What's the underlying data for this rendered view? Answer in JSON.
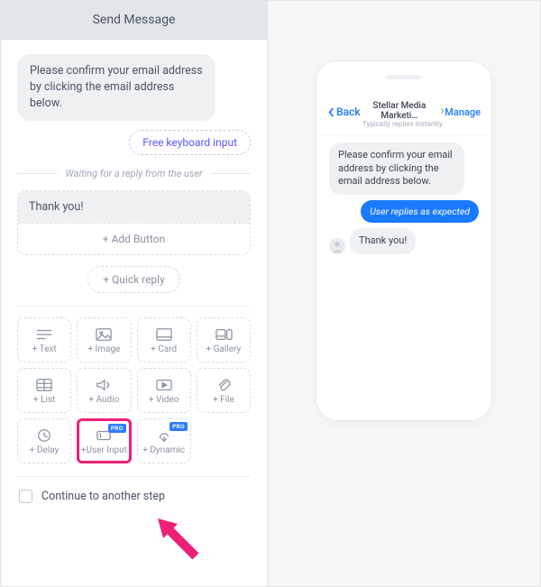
{
  "builder": {
    "title": "Send Message",
    "message1": "Please confirm your email address by clicking the email address below.",
    "keyboard_pill": "Free keyboard input",
    "waiting_text": "Waiting for a reply from the user",
    "message2": "Thank you!",
    "add_button": "+ Add Button",
    "quick_reply": "+ Quick reply",
    "pro_label": "PRO",
    "blocks": {
      "text": "+ Text",
      "image": "+ Image",
      "card": "+ Card",
      "gallery": "+ Gallery",
      "list": "+ List",
      "audio": "+ Audio",
      "video": "+ Video",
      "file": "+ File",
      "delay": "+ Delay",
      "user_input": "+User Input",
      "dynamic": "+ Dynamic"
    },
    "continue_label": "Continue to another step"
  },
  "preview": {
    "back_label": "Back",
    "title": "Stellar Media Marketi…",
    "subtitle": "Typically replies instantly",
    "manage_label": "Manage",
    "chat": {
      "incoming1": "Please confirm your email address by clicking the email address below.",
      "outgoing1": "User replies as expected",
      "incoming2": "Thank you!"
    }
  }
}
